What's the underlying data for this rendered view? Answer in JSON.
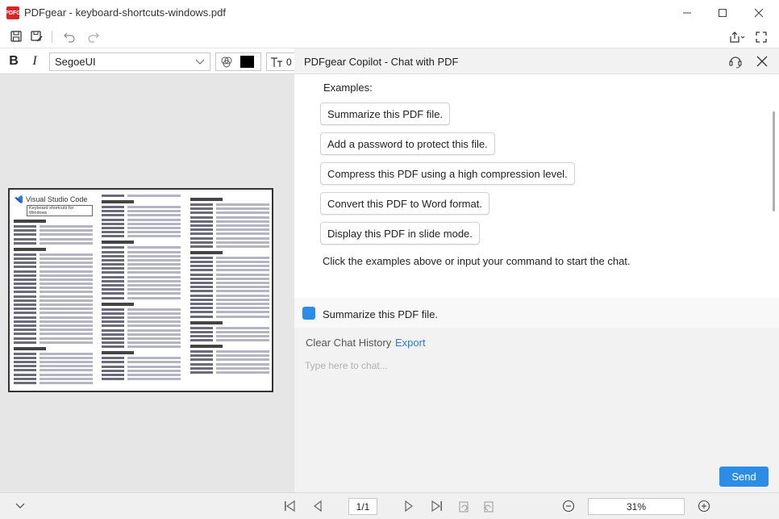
{
  "window": {
    "logo_text": "PDFG",
    "title": "PDFgear - keyboard-shortcuts-windows.pdf"
  },
  "format_bar": {
    "bold_label": "B",
    "italic_label": "I",
    "font_name": "SegoeUI",
    "font_size": "0"
  },
  "copilot": {
    "title": "PDFgear Copilot - Chat with PDF",
    "examples_label": "Examples:",
    "examples": [
      "Summarize this PDF file.",
      "Add a password to protect this file.",
      "Compress this PDF using a high compression level.",
      "Convert this PDF to Word format.",
      "Display this PDF in slide mode."
    ],
    "hint": "Click the examples above or input your command to start the chat.",
    "user_message": "Summarize this PDF file.",
    "clear_history_label": "Clear Chat History",
    "export_label": "Export",
    "input_placeholder": "Type here to chat...",
    "send_label": "Send"
  },
  "pdf_preview": {
    "doc_title": "Visual Studio Code",
    "doc_subtitle": "Keyboard shortcuts for Windows"
  },
  "navigation": {
    "page_indicator": "1/1",
    "zoom": "31%"
  },
  "colors": {
    "accent": "#2b8de6",
    "link": "#2b7bd6",
    "logo": "#d9262b"
  }
}
